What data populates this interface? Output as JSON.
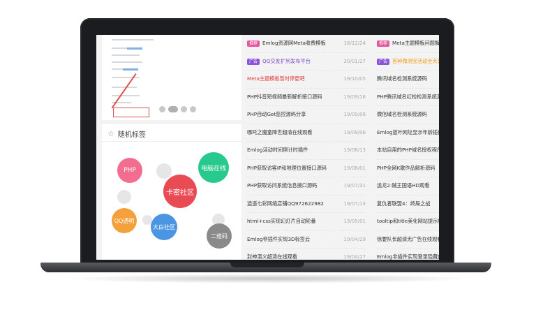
{
  "colors": {
    "badge_recommend": "#e7559e",
    "badge_ad": "#8a55d9",
    "bubble_php": "#f26d8f",
    "bubble_kami": "#e94b55",
    "bubble_pc": "#27c98d",
    "bubble_qq": "#f5a13b",
    "bubble_dabai": "#4b95e3",
    "bubble_qr": "#8a8a8a"
  },
  "tags": {
    "title": "随机标签",
    "items": [
      "PHP",
      "卡密社区",
      "电脑在线",
      "QQ透明",
      "大白社区",
      "二维码"
    ]
  },
  "list_a": [
    {
      "badge": "推荐",
      "title": "Emlog资源网Meta收费模板",
      "date": "18/12/24"
    },
    {
      "badge": "广告",
      "title": "QQ交友扩列发布平台",
      "date": "20/01/27",
      "style": "purple"
    },
    {
      "title": "Meta主题模板暂时停更吧",
      "date": "19/10/05",
      "style": "red"
    },
    {
      "title": "PHP抖音短视频最新解析接口源码",
      "date": "19/09/16"
    },
    {
      "title": "PHP自动Get监控源码分享",
      "date": "19/09/06"
    },
    {
      "title": "哪吒之魔童降世超清在线观看",
      "date": "19/09/06"
    },
    {
      "title": "Emlog活动时间倒计时插件",
      "date": "19/08/13"
    },
    {
      "title": "PHP获取访客IP和地理位置接口源码",
      "date": "19/08/01"
    },
    {
      "title": "PHP获取访问系统信息接口源码",
      "date": "19/07/31"
    },
    {
      "title": "逍遥七彩网络店铺QQ972622982",
      "date": "19/07/13"
    },
    {
      "title": "html+css实现幻灯片自动轮番",
      "date": "19/05/01"
    },
    {
      "title": "Emlog非插件实现3D标签云",
      "date": "19/04/29"
    },
    {
      "title": "封神演义超清在线观看",
      "date": "19/04/27"
    }
  ],
  "list_b": [
    {
      "badge": "推荐",
      "title": "Meta主题模板问题解答帮助",
      "badge_kind": "recommend"
    },
    {
      "badge": "广告",
      "title": "首种微测宝活动全天领",
      "style": "orange"
    },
    {
      "title": "腾讯域名检测系统源码"
    },
    {
      "title": "PHP腾讯域名红检检测系统源码"
    },
    {
      "title": "微信域名检测系统源码"
    },
    {
      "title": "Emlog蓝叶网址显示年龄插件"
    },
    {
      "title": "本站自用的PHP域名授权程序"
    },
    {
      "title": "PHP全网K歌作品解析源码"
    },
    {
      "title": "追龙2:贼王国语HD观看"
    },
    {
      "title": "复仇者联盟4：终局之战"
    },
    {
      "title": "tooltip和title美化网站提示框"
    },
    {
      "title": "徐要队长超清无广告在线观看"
    },
    {
      "title": "Emlog非插件实现登录隐藏内容"
    }
  ]
}
